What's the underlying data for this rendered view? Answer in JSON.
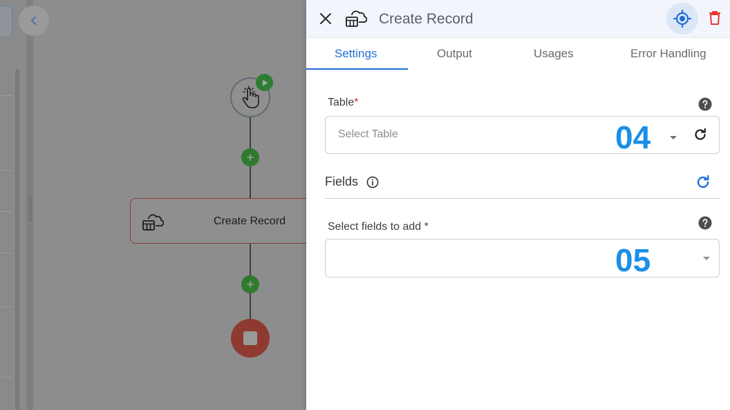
{
  "canvas": {
    "node_label": "Create Record"
  },
  "panel": {
    "title": "Create Record",
    "tabs": [
      {
        "label": "Settings",
        "active": true
      },
      {
        "label": "Output",
        "active": false
      },
      {
        "label": "Usages",
        "active": false
      },
      {
        "label": "Error Handling",
        "active": false
      }
    ],
    "table": {
      "label": "Table",
      "required_mark": "*",
      "placeholder": "Select Table",
      "step_overlay": "04"
    },
    "fields_section": {
      "label": "Fields"
    },
    "fields": {
      "label": "Select fields to add *",
      "value": "",
      "step_overlay": "05"
    }
  },
  "colors": {
    "accent": "#1f6fd6",
    "step_overlay": "#1a8fe6",
    "delete": "#e53935",
    "add": "#2f7a2f",
    "end_node": "#8f3a30"
  },
  "icons": [
    "collapse-chevron-icon",
    "touch-trigger-icon",
    "play-icon",
    "plus-icon",
    "database-cloud-icon",
    "stop-icon",
    "close-icon",
    "locate-icon",
    "trash-icon",
    "help-icon",
    "refresh-icon",
    "info-icon",
    "caret-down-icon"
  ]
}
